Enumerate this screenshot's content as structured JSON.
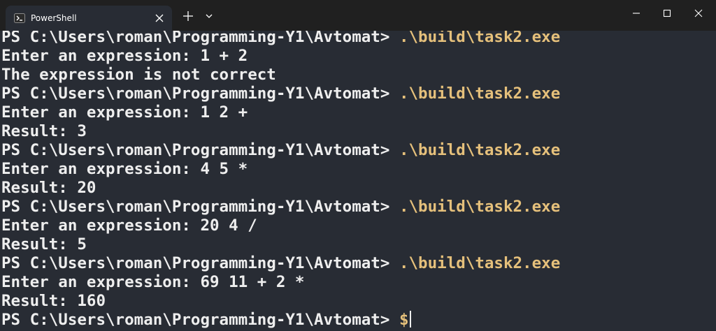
{
  "window": {
    "tab_title": "PowerShell",
    "icons": {
      "tab": "powershell-icon",
      "close_tab": "close-icon",
      "new_tab": "plus-icon",
      "dropdown": "chevron-down-icon",
      "minimize": "minimize-icon",
      "maximize": "maximize-icon",
      "close": "close-icon"
    }
  },
  "terminal": {
    "colors": {
      "background": "#282c34",
      "text": "#eeeeee",
      "command": "#e5c07b"
    },
    "lines": [
      {
        "prompt": "PS C:\\Users\\roman\\Programming-Y1\\Avtomat> ",
        "command": ".\\build\\task2.exe"
      },
      {
        "text": "Enter an expression: 1 + 2"
      },
      {
        "text": "The expression is not correct"
      },
      {
        "prompt": "PS C:\\Users\\roman\\Programming-Y1\\Avtomat> ",
        "command": ".\\build\\task2.exe"
      },
      {
        "text": "Enter an expression: 1 2 +"
      },
      {
        "text": "Result: 3"
      },
      {
        "prompt": "PS C:\\Users\\roman\\Programming-Y1\\Avtomat> ",
        "command": ".\\build\\task2.exe"
      },
      {
        "text": "Enter an expression: 4 5 *"
      },
      {
        "text": "Result: 20"
      },
      {
        "prompt": "PS C:\\Users\\roman\\Programming-Y1\\Avtomat> ",
        "command": ".\\build\\task2.exe"
      },
      {
        "text": "Enter an expression: 20 4 /"
      },
      {
        "text": "Result: 5"
      },
      {
        "prompt": "PS C:\\Users\\roman\\Programming-Y1\\Avtomat> ",
        "command": ".\\build\\task2.exe"
      },
      {
        "text": "Enter an expression: 69 11 + 2 *"
      },
      {
        "text": "Result: 160"
      },
      {
        "prompt": "PS C:\\Users\\roman\\Programming-Y1\\Avtomat> ",
        "command": "$"
      }
    ]
  }
}
